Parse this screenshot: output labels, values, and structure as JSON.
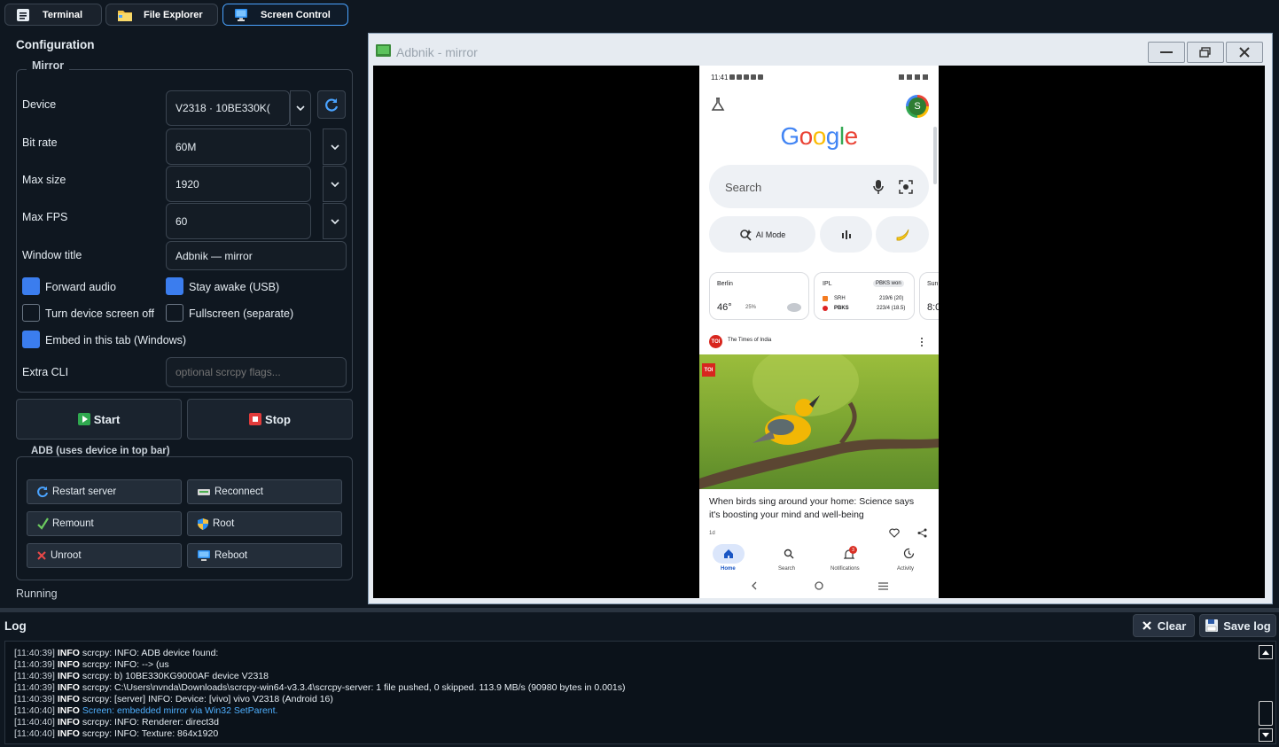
{
  "tabs": [
    {
      "label": "Terminal",
      "icon": "terminal-icon"
    },
    {
      "label": "File Explorer",
      "icon": "folder-icon"
    },
    {
      "label": "Screen Control",
      "icon": "monitor-icon"
    }
  ],
  "config": {
    "title": "Configuration",
    "mirror_group": "Mirror",
    "device_label": "Device",
    "device_value": "V2318 · 10BE330K(",
    "bitrate_label": "Bit rate",
    "bitrate_value": "60M",
    "maxsize_label": "Max size",
    "maxsize_value": "1920",
    "maxfps_label": "Max FPS",
    "maxfps_value": "60",
    "wintitle_label": "Window title",
    "wintitle_value": "Adbnik — mirror",
    "checkboxes": [
      {
        "label": "Forward audio",
        "checked": true
      },
      {
        "label": "Stay awake (USB)",
        "checked": true
      },
      {
        "label": "Turn device screen off",
        "checked": false
      },
      {
        "label": "Fullscreen (separate)",
        "checked": false
      },
      {
        "label": "Embed in this tab (Windows)",
        "checked": true
      }
    ],
    "extracli_label": "Extra CLI",
    "extracli_placeholder": "optional scrcpy flags...",
    "start_label": "Start",
    "stop_label": "Stop",
    "adb_group": "ADB (uses device in top bar)",
    "adb_buttons": [
      "Restart server",
      "Reconnect",
      "Remount",
      "Root",
      "Unroot",
      "Reboot"
    ],
    "status": "Running"
  },
  "mirror": {
    "window_title": "Adbnik - mirror",
    "phone": {
      "status_time": "11:41",
      "avatar": "S",
      "search_placeholder": "Search",
      "ai_mode": "AI Mode",
      "weather_city": "Berlin",
      "weather_temp": "46°",
      "weather_rain": "25%",
      "ipl_label": "IPL",
      "ipl_badge": "PBKS won",
      "ipl_team1": "SRH",
      "ipl_score1": "219/6 (20)",
      "ipl_team2": "PBKS",
      "ipl_score2": "223/4 (18.5)",
      "third_card_top": "Sun",
      "third_card_val": "8:0",
      "news_source": "The Times of India",
      "news_headline": "When birds sing around your home: Science says it's boosting your mind and well-being",
      "news_age": "1d",
      "nav": [
        "Home",
        "Search",
        "Notifications",
        "Activity"
      ],
      "notif_count": "3"
    }
  },
  "log": {
    "title": "Log",
    "clear_label": "Clear",
    "save_label": "Save log",
    "lines": [
      {
        "ts": "[11:40:39]",
        "lv": "INFO",
        "msg": "scrcpy: INFO: ADB device found:",
        "hl": false
      },
      {
        "ts": "[11:40:39]",
        "lv": "INFO",
        "msg": "scrcpy: INFO: --> (us",
        "hl": false
      },
      {
        "ts": "[11:40:39]",
        "lv": "INFO",
        "msg": "scrcpy: b) 10BE330KG9000AF device V2318",
        "hl": false
      },
      {
        "ts": "[11:40:39]",
        "lv": "INFO",
        "msg": "scrcpy: C:\\Users\\nvnda\\Downloads\\scrcpy-win64-v3.3.4\\scrcpy-server: 1 file pushed, 0 skipped. 113.9 MB/s (90980 bytes in 0.001s)",
        "hl": false
      },
      {
        "ts": "[11:40:39]",
        "lv": "INFO",
        "msg": "scrcpy: [server] INFO: Device: [vivo] vivo V2318 (Android 16)",
        "hl": false
      },
      {
        "ts": "[11:40:40]",
        "lv": "INFO",
        "msg": "Screen: embedded mirror via Win32 SetParent.",
        "hl": true
      },
      {
        "ts": "[11:40:40]",
        "lv": "INFO",
        "msg": "scrcpy: INFO: Renderer: direct3d",
        "hl": false
      },
      {
        "ts": "[11:40:40]",
        "lv": "INFO",
        "msg": "scrcpy: INFO: Texture: 864x1920",
        "hl": false
      }
    ]
  },
  "colors": {
    "accent": "#3b7dee",
    "tab_active_border": "#4aa3ff",
    "highlight_log": "#4fb0ff"
  }
}
